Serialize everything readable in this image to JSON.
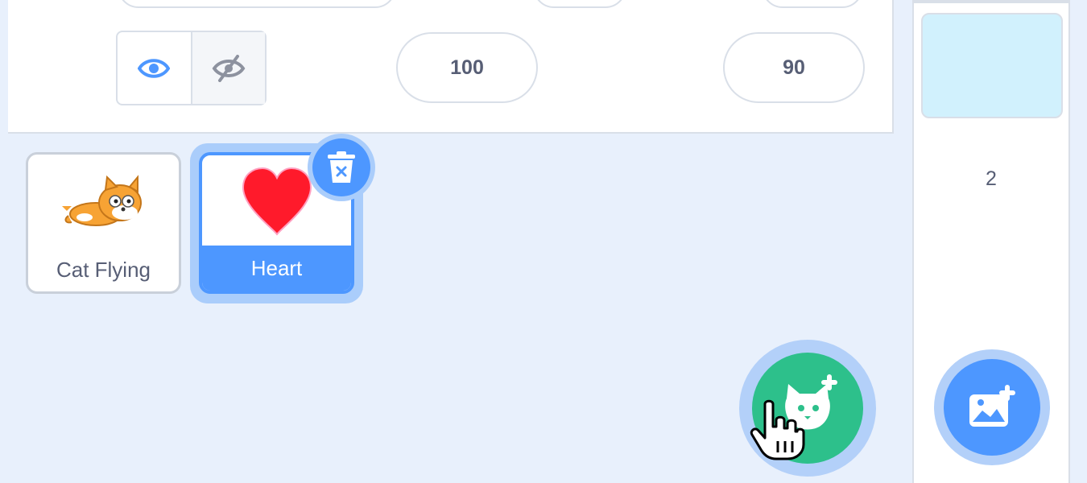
{
  "sprite_info": {
    "size_value": "100",
    "direction_value": "90",
    "visibility_icons": [
      "eye-icon",
      "eye-crossed-icon"
    ]
  },
  "sprites": [
    {
      "name": "Cat Flying",
      "selected": false,
      "icon": "cat-flying-icon"
    },
    {
      "name": "Heart",
      "selected": true,
      "icon": "heart-icon"
    }
  ],
  "stage": {
    "backdrop_count": "2"
  },
  "colors": {
    "accent": "#4d97ff",
    "add_sprite": "#2dc08b",
    "panel_bg": "#e8f0fc",
    "stage_thumb": "#d1f1fd"
  },
  "icons": {
    "delete": "trash-icon",
    "add_sprite": "add-sprite-cat-icon",
    "add_backdrop": "add-backdrop-image-icon",
    "cursor": "hand-cursor-icon"
  }
}
